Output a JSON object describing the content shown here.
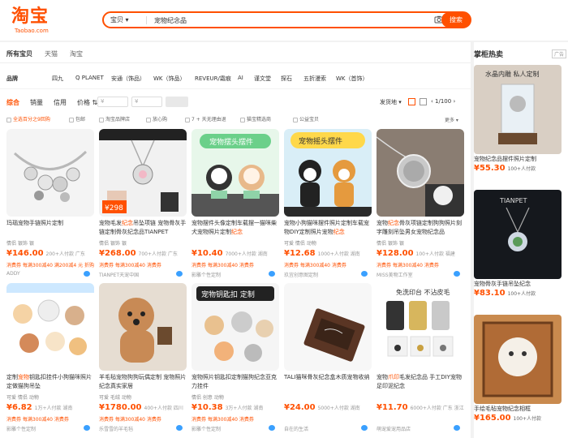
{
  "logo": {
    "cn": "淘宝",
    "en": "Taobao.com"
  },
  "search": {
    "category": "宝贝",
    "query": "宠物纪念品",
    "button": "搜索"
  },
  "tabs": [
    "所有宝贝",
    "天猫",
    "淘宝"
  ],
  "brand_label": "品牌",
  "brands": [
    "四九",
    "Q PLANET",
    "安通（饰品）",
    "WK（饰品）",
    "REVEUR/霜痕",
    "AI",
    "谨文堂",
    "探石",
    "五折漫索",
    "WK（首饰）"
  ],
  "sort": {
    "items": [
      "综合",
      "销量",
      "信用",
      "价格"
    ],
    "price_min": "¥",
    "price_max": "¥",
    "ship_to": "发货地",
    "pager": "1/100"
  },
  "filters": [
    "全选百分之9回购",
    "包邮",
    "淘宝品牌店",
    "放心购",
    "7 + 天无理由退",
    "猫宝精选商",
    "公益宝贝"
  ],
  "filter_more": "更多",
  "products": [
    {
      "title_pre": "玛瑙宠物手链照片定制",
      "title_hl": "",
      "title_post": "",
      "tags": "情侣  银饰  银",
      "price": "¥146.00",
      "sales": "200+人付款  广东",
      "promo": "消费券 每满300减40 满200减4 元 折购",
      "shop": "ADDY"
    },
    {
      "title_pre": "宠物毛发",
      "title_hl": "纪念",
      "title_post": "吊坠项链 宠物骨灰手链定制骨灰纪念品TIANPET",
      "tags": "情侣  银饰  银",
      "price": "¥268.00",
      "sales": "700+人付款  广东",
      "promo": "消费券 每满300减40 消费券",
      "shop": "TIANPET天宠中国"
    },
    {
      "title_pre": "宠物摆件头像定制车载摆一猫咪柴犬宠物照片定制",
      "title_hl": "纪念",
      "title_post": "",
      "tags": "",
      "price": "¥10.40",
      "sales": "7000+人付款  湖南",
      "promo": "消费券 每满300减40 消费券",
      "shop": "影雕个性定制"
    },
    {
      "title_pre": "宠物小狗猫咪摆件照片定制车载宠物DIY定制照片宠物",
      "title_hl": "纪念",
      "title_post": "",
      "tags": "可爱  情侣  动物",
      "price": "¥12.68",
      "sales": "1000+人付款  湖南",
      "promo": "消费券 每满300减40 消费券",
      "shop": "玖宜创意图定制"
    },
    {
      "title_pre": "宠物",
      "title_hl": "纪念",
      "title_post": "骨灰项链定制狗狗照片刻字雕刻吊坠男女宠物纪念品",
      "tags": "情侣  银饰  银",
      "price": "¥128.00",
      "sales": "100+人付款  福建",
      "promo": "消费券 每满300减40 消费券",
      "shop": "MISS美物工作室"
    },
    {
      "title_pre": "定制",
      "title_hl": "宠物",
      "title_post": "钥匙扣挂件小狗猫咪照片定做猫狗吊坠",
      "tags": "可爱  情侣  动物",
      "price": "¥6.82",
      "sales": "1万+人付款  湖南",
      "promo": "消费券 每满300减40 消费券",
      "shop": "影雕个性定制"
    },
    {
      "title_pre": "羊毛毡宠物",
      "title_hl": "",
      "title_post": "狗狗玩偶定制 宠物照片纪念真实家居",
      "tags": "可爱  毛绒  动物",
      "price": "¥1780.00",
      "sales": "400+人付款  四川",
      "promo": "消费券 每满300减40 消费券",
      "shop": "乐雪雪的羊毛毡"
    },
    {
      "title_pre": "宠物照片钥匙扣定制",
      "title_hl": "",
      "title_post": "猫狗纪念亚克力挂件",
      "tags": "情侣  创意  动物",
      "price": "¥10.38",
      "sales": "3万+人付款  湖南",
      "promo": "消费券 每满300减40 消费券",
      "shop": "影雕个性定制"
    },
    {
      "title_pre": "TALI猫咪骨灰纪念盒",
      "title_hl": "",
      "title_post": "木质宠物收纳",
      "tags": "",
      "price": "¥24.00",
      "sales": "5000+人付款  湖南",
      "promo": "",
      "shop": "自在的生活"
    },
    {
      "title_pre": "宠物",
      "title_hl": "爪印",
      "title_post": "毛发纪念品 手工DIY宠物足印泥纪念",
      "tags": "",
      "price": "¥11.70",
      "sales": "6000+人付款  广东  浙江",
      "promo": "",
      "shop": "萌宠爱宠用品店"
    }
  ],
  "side": {
    "header": "掌柜热卖",
    "ad_label": "广告",
    "items": [
      {
        "title": "宠物纪念品摆件照片定制",
        "price": "¥55.30",
        "sales": "100+人付款"
      },
      {
        "title": "宠物骨灰手链吊坠纪念",
        "price": "¥83.10",
        "sales": "100+人付款"
      },
      {
        "title": "手绘毛毡宠物纪念相框",
        "price": "¥165.00",
        "sales": "100+人付款"
      }
    ]
  },
  "product_images": [
    "bracelet",
    "pendant",
    "car-figure",
    "cat-dog-figure",
    "necklace",
    "keychain",
    "plush-dog",
    "acrylic-keychain",
    "wood-box",
    "paw-print"
  ],
  "overlay_texts": {
    "p2_price": "¥298",
    "p3_banner": "宠物摆头摆件",
    "p4_banner": "宠物摇头摆件",
    "p8_banner": "宠物钥匙扣 定制",
    "p10_banner": "免洗印台 不沾皮毛",
    "side1_banner": "水晶内雕 私人定制",
    "side2_brand": "TIANPET"
  }
}
